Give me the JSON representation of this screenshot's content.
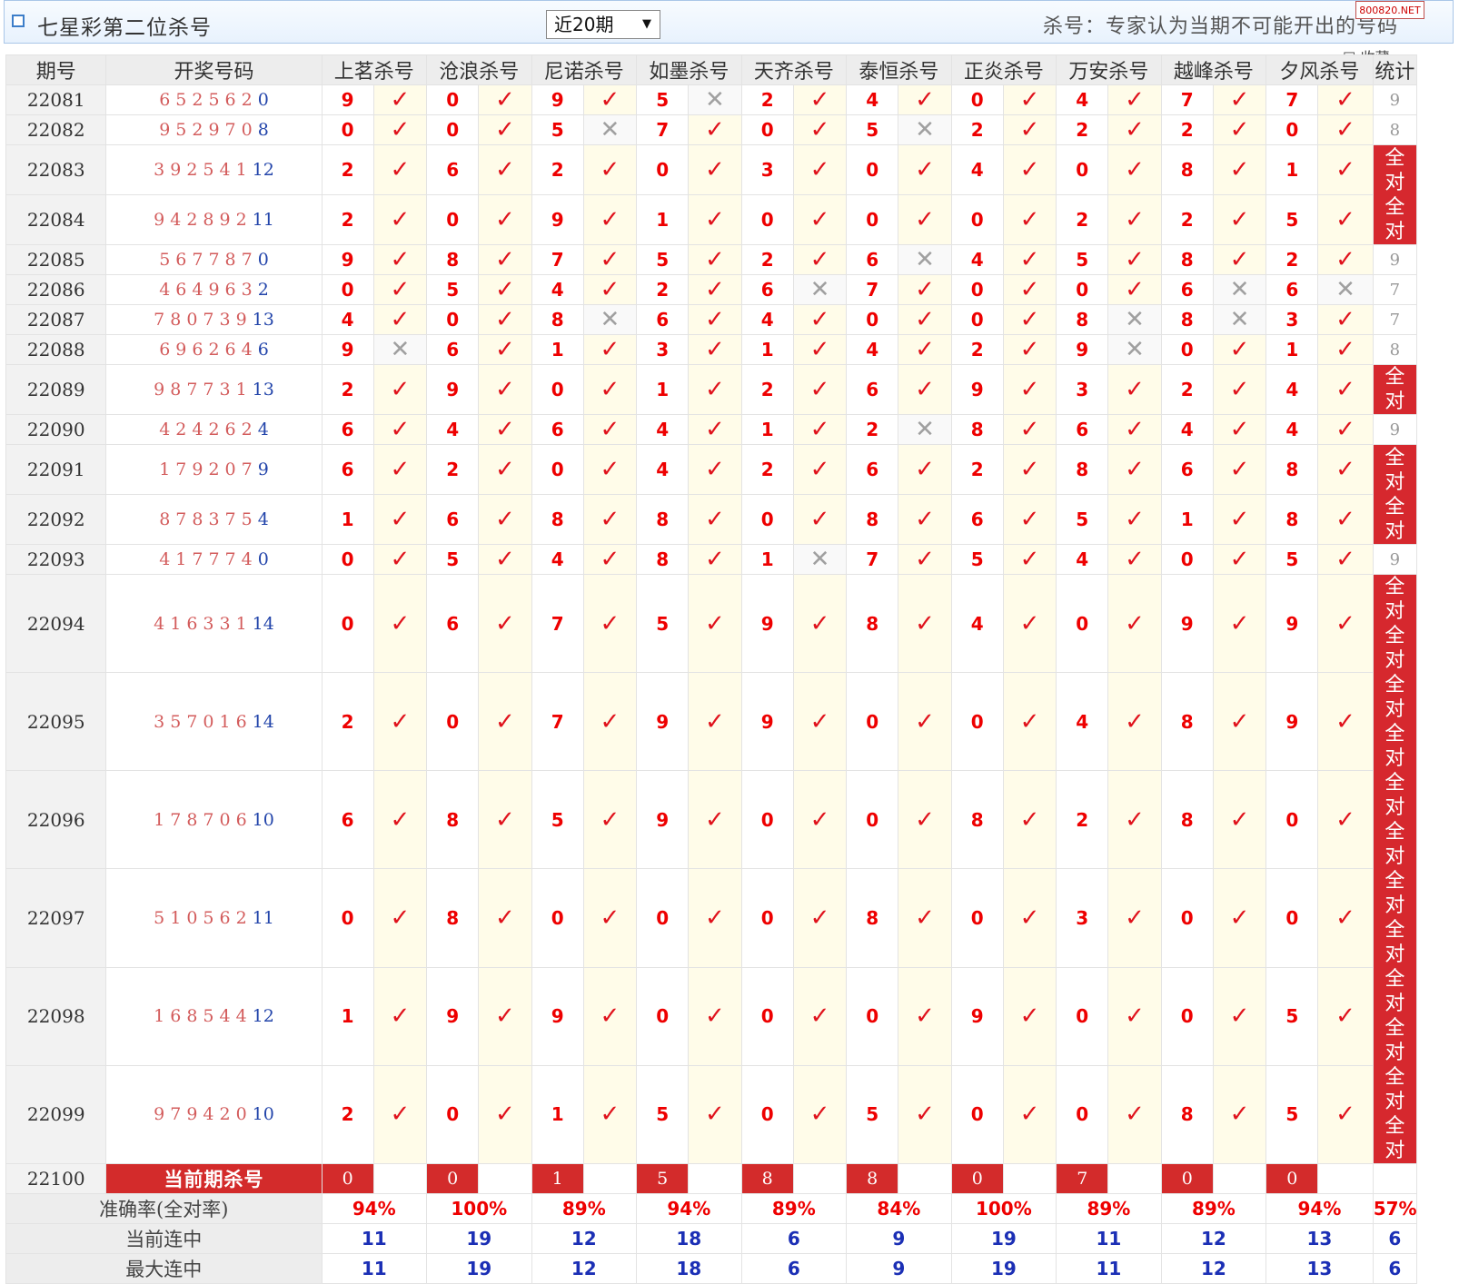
{
  "topbar": {
    "title": "七星彩第二位杀号",
    "period_select": "近20期",
    "note": "杀号：专家认为当期不可能开出的号码",
    "watermark": "800820.NET",
    "fav_label": "收藏"
  },
  "headers": [
    "期号",
    "开奖号码",
    "上茗杀号",
    "沧浪杀号",
    "尼诺杀号",
    "如墨杀号",
    "天齐杀号",
    "泰恒杀号",
    "正炎杀号",
    "万安杀号",
    "越峰杀号",
    "夕风杀号",
    "统计"
  ],
  "rows": [
    {
      "p": "22081",
      "d": "652562",
      "e": "0",
      "k": [
        "9",
        "0",
        "9",
        "5",
        "2",
        "4",
        "0",
        "4",
        "7",
        "7"
      ],
      "r": [
        1,
        1,
        1,
        0,
        1,
        1,
        1,
        1,
        1,
        1
      ],
      "s": "9"
    },
    {
      "p": "22082",
      "d": "952970",
      "e": "8",
      "k": [
        "0",
        "0",
        "5",
        "7",
        "0",
        "5",
        "2",
        "2",
        "2",
        "0"
      ],
      "r": [
        1,
        1,
        0,
        1,
        1,
        0,
        1,
        1,
        1,
        1
      ],
      "s": "8"
    },
    {
      "p": "22083",
      "d": "392541",
      "e": "12",
      "k": [
        "2",
        "6",
        "2",
        "0",
        "3",
        "0",
        "4",
        "0",
        "8",
        "1"
      ],
      "r": [
        1,
        1,
        1,
        1,
        1,
        1,
        1,
        1,
        1,
        1
      ],
      "s": "全对全对",
      "span": 2
    },
    {
      "p": "22084",
      "d": "942892",
      "e": "11",
      "k": [
        "2",
        "0",
        "9",
        "1",
        "0",
        "0",
        "0",
        "2",
        "2",
        "5"
      ],
      "r": [
        1,
        1,
        1,
        1,
        1,
        1,
        1,
        1,
        1,
        1
      ]
    },
    {
      "p": "22085",
      "d": "567787",
      "e": "0",
      "k": [
        "9",
        "8",
        "7",
        "5",
        "2",
        "6",
        "4",
        "5",
        "8",
        "2"
      ],
      "r": [
        1,
        1,
        1,
        1,
        1,
        0,
        1,
        1,
        1,
        1
      ],
      "s": "9"
    },
    {
      "p": "22086",
      "d": "464963",
      "e": "2",
      "k": [
        "0",
        "5",
        "4",
        "2",
        "6",
        "7",
        "0",
        "0",
        "6",
        "6"
      ],
      "r": [
        1,
        1,
        1,
        1,
        0,
        1,
        1,
        1,
        0,
        0
      ],
      "s": "7"
    },
    {
      "p": "22087",
      "d": "780739",
      "e": "13",
      "k": [
        "4",
        "0",
        "8",
        "6",
        "4",
        "0",
        "0",
        "8",
        "8",
        "3"
      ],
      "r": [
        1,
        1,
        0,
        1,
        1,
        1,
        1,
        0,
        0,
        1
      ],
      "s": "7"
    },
    {
      "p": "22088",
      "d": "696264",
      "e": "6",
      "k": [
        "9",
        "6",
        "1",
        "3",
        "1",
        "4",
        "2",
        "9",
        "0",
        "1"
      ],
      "r": [
        0,
        1,
        1,
        1,
        1,
        1,
        1,
        0,
        1,
        1
      ],
      "s": "8"
    },
    {
      "p": "22089",
      "d": "987731",
      "e": "13",
      "k": [
        "2",
        "9",
        "0",
        "1",
        "2",
        "6",
        "9",
        "3",
        "2",
        "4"
      ],
      "r": [
        1,
        1,
        1,
        1,
        1,
        1,
        1,
        1,
        1,
        1
      ],
      "s": "全对",
      "span": 1
    },
    {
      "p": "22090",
      "d": "424262",
      "e": "4",
      "k": [
        "6",
        "4",
        "6",
        "4",
        "1",
        "2",
        "8",
        "6",
        "4",
        "4"
      ],
      "r": [
        1,
        1,
        1,
        1,
        1,
        0,
        1,
        1,
        1,
        1
      ],
      "s": "9"
    },
    {
      "p": "22091",
      "d": "179207",
      "e": "9",
      "k": [
        "6",
        "2",
        "0",
        "4",
        "2",
        "6",
        "2",
        "8",
        "6",
        "8"
      ],
      "r": [
        1,
        1,
        1,
        1,
        1,
        1,
        1,
        1,
        1,
        1
      ],
      "s": "全对全对",
      "span": 2
    },
    {
      "p": "22092",
      "d": "878375",
      "e": "4",
      "k": [
        "1",
        "6",
        "8",
        "8",
        "0",
        "8",
        "6",
        "5",
        "1",
        "8"
      ],
      "r": [
        1,
        1,
        1,
        1,
        1,
        1,
        1,
        1,
        1,
        1
      ]
    },
    {
      "p": "22093",
      "d": "417774",
      "e": "0",
      "k": [
        "0",
        "5",
        "4",
        "8",
        "1",
        "7",
        "5",
        "4",
        "0",
        "5"
      ],
      "r": [
        1,
        1,
        1,
        1,
        0,
        1,
        1,
        1,
        1,
        1
      ],
      "s": "9"
    },
    {
      "p": "22094",
      "d": "416331",
      "e": "14",
      "k": [
        "0",
        "6",
        "7",
        "5",
        "9",
        "8",
        "4",
        "0",
        "9",
        "9"
      ],
      "r": [
        1,
        1,
        1,
        1,
        1,
        1,
        1,
        1,
        1,
        1
      ],
      "s": "全对全对全对全对全对全对全对全对全对全对全对全对",
      "span": 6
    },
    {
      "p": "22095",
      "d": "357016",
      "e": "14",
      "k": [
        "2",
        "0",
        "7",
        "9",
        "9",
        "0",
        "0",
        "4",
        "8",
        "9"
      ],
      "r": [
        1,
        1,
        1,
        1,
        1,
        1,
        1,
        1,
        1,
        1
      ]
    },
    {
      "p": "22096",
      "d": "178706",
      "e": "10",
      "k": [
        "6",
        "8",
        "5",
        "9",
        "0",
        "0",
        "8",
        "2",
        "8",
        "0"
      ],
      "r": [
        1,
        1,
        1,
        1,
        1,
        1,
        1,
        1,
        1,
        1
      ]
    },
    {
      "p": "22097",
      "d": "510562",
      "e": "11",
      "k": [
        "0",
        "8",
        "0",
        "0",
        "0",
        "8",
        "0",
        "3",
        "0",
        "0"
      ],
      "r": [
        1,
        1,
        1,
        1,
        1,
        1,
        1,
        1,
        1,
        1
      ]
    },
    {
      "p": "22098",
      "d": "168544",
      "e": "12",
      "k": [
        "1",
        "9",
        "9",
        "0",
        "0",
        "0",
        "9",
        "0",
        "0",
        "5"
      ],
      "r": [
        1,
        1,
        1,
        1,
        1,
        1,
        1,
        1,
        1,
        1
      ]
    },
    {
      "p": "22099",
      "d": "979420",
      "e": "10",
      "k": [
        "2",
        "0",
        "1",
        "5",
        "0",
        "5",
        "0",
        "0",
        "8",
        "5"
      ],
      "r": [
        1,
        1,
        1,
        1,
        1,
        1,
        1,
        1,
        1,
        1
      ]
    }
  ],
  "current": {
    "p": "22100",
    "label": "当前期杀号",
    "k": [
      "0",
      "0",
      "1",
      "5",
      "8",
      "8",
      "0",
      "7",
      "0",
      "0"
    ]
  },
  "stats": {
    "rate": {
      "label": "准确率(全对率)",
      "v": [
        "94%",
        "100%",
        "89%",
        "94%",
        "89%",
        "84%",
        "100%",
        "89%",
        "89%",
        "94%"
      ],
      "total": "57%"
    },
    "cur": {
      "label": "当前连中",
      "v": [
        "11",
        "19",
        "12",
        "18",
        "6",
        "9",
        "19",
        "11",
        "12",
        "13"
      ],
      "total": "6"
    },
    "max": {
      "label": "最大连中",
      "v": [
        "11",
        "19",
        "12",
        "18",
        "6",
        "9",
        "19",
        "11",
        "12",
        "13"
      ],
      "total": "6"
    }
  },
  "marks": {
    "ok": "✓",
    "no": "✕"
  }
}
